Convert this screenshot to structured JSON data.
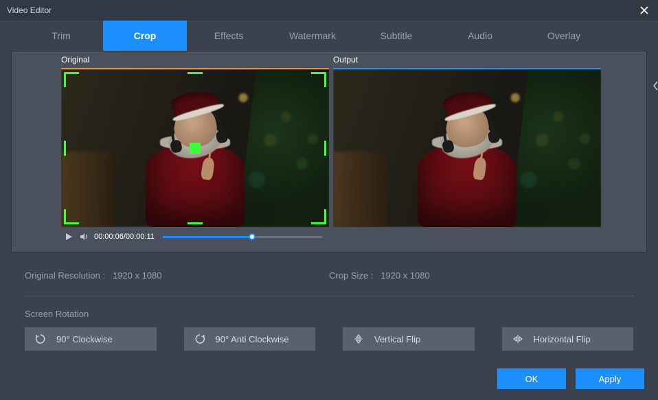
{
  "window": {
    "title": "Video Editor"
  },
  "tabs": {
    "items": [
      "Trim",
      "Crop",
      "Effects",
      "Watermark",
      "Subtitle",
      "Audio",
      "Overlay"
    ],
    "active_index": 1
  },
  "previews": {
    "original_label": "Original",
    "output_label": "Output"
  },
  "playbar": {
    "current": "00:00:06",
    "total": "00:00:11",
    "progress_pct": 56
  },
  "info": {
    "original_res_label": "Original Resolution :",
    "original_res_value": "1920 x 1080",
    "crop_size_label": "Crop Size :",
    "crop_size_value": "1920 x 1080"
  },
  "rotation": {
    "section_label": "Screen Rotation",
    "buttons": {
      "cw": "90° Clockwise",
      "ccw": "90° Anti Clockwise",
      "vflip": "Vertical Flip",
      "hflip": "Horizontal Flip"
    }
  },
  "footer": {
    "ok": "OK",
    "apply": "Apply"
  }
}
